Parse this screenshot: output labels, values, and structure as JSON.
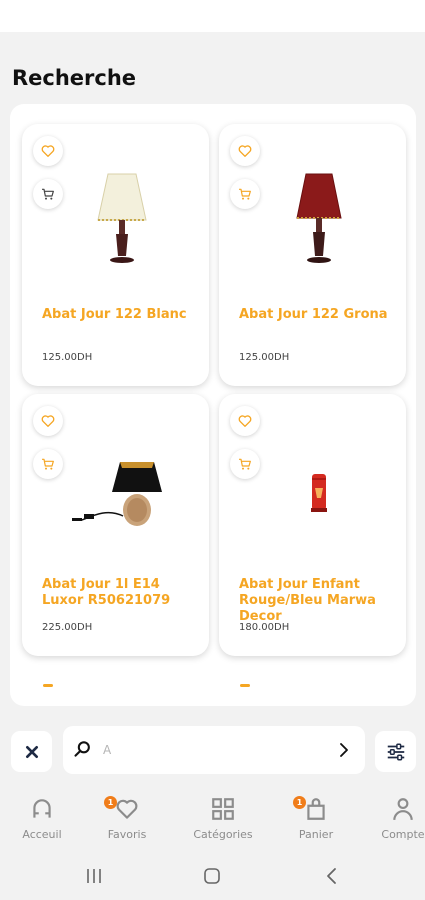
{
  "page": {
    "title": "Recherche"
  },
  "products": [
    {
      "name": "Abat Jour 122 Blanc",
      "price": "125.00DH",
      "image": "lamp-white-shade"
    },
    {
      "name": "Abat Jour 122 Grona",
      "price": "125.00DH",
      "image": "lamp-red-shade"
    },
    {
      "name": "Abat Jour 1l E14 Luxor R50621079",
      "price": "225.00DH",
      "image": "lamp-black-shade"
    },
    {
      "name": "Abat Jour Enfant Rouge/Bleu Marwa Decor",
      "price": "180.00DH",
      "image": "lamp-red-cylinder"
    }
  ],
  "search": {
    "value": "",
    "placeholder": "A"
  },
  "icons": {
    "clear": "close-icon",
    "search": "search-icon",
    "submit": "chevron-right-icon",
    "filter": "sliders-icon",
    "favorite": "heart-icon",
    "cart": "cart-icon"
  },
  "nav": {
    "items": [
      {
        "label": "Acceuil",
        "icon": "home-icon"
      },
      {
        "label": "Favoris",
        "icon": "heart-icon",
        "badge": "1"
      },
      {
        "label": "Catégories",
        "icon": "grid-icon"
      },
      {
        "label": "Panier",
        "icon": "bag-icon",
        "badge": "1"
      },
      {
        "label": "Compte",
        "icon": "user-icon"
      }
    ]
  },
  "colors": {
    "accent": "#f5a623",
    "badge": "#f07d1a",
    "dark": "#1e2a44",
    "background": "#f2f2f2"
  }
}
